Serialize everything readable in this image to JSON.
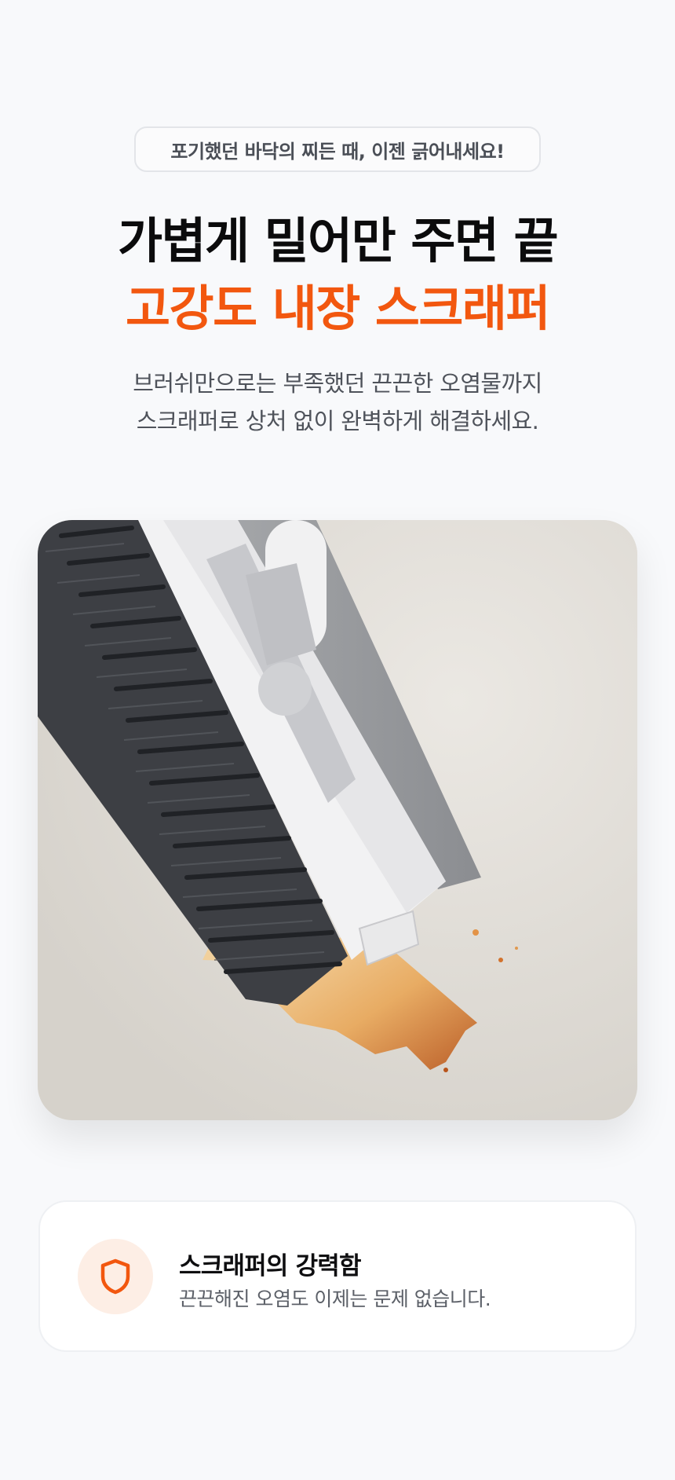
{
  "badge": "포기했던 바닥의 찌든 때, 이젠 긁어내세요!",
  "headline": {
    "line1": "가볍게 밀어만 주면 끝",
    "line2": "고강도 내장 스크래퍼"
  },
  "description": {
    "line1": "브러쉬만으로는 부족했던 끈끈한 오염물까지",
    "line2": "스크래퍼로 상처 없이 완벽하게 해결하세요."
  },
  "colors": {
    "accent": "#f2570f",
    "background": "#f8f9fb",
    "icon_bg": "#fdeee5"
  },
  "feature": {
    "icon": "shield-icon",
    "title": "스크래퍼의 강력함",
    "description": "끈끈해진 오염도 이제는 문제 없습니다."
  }
}
